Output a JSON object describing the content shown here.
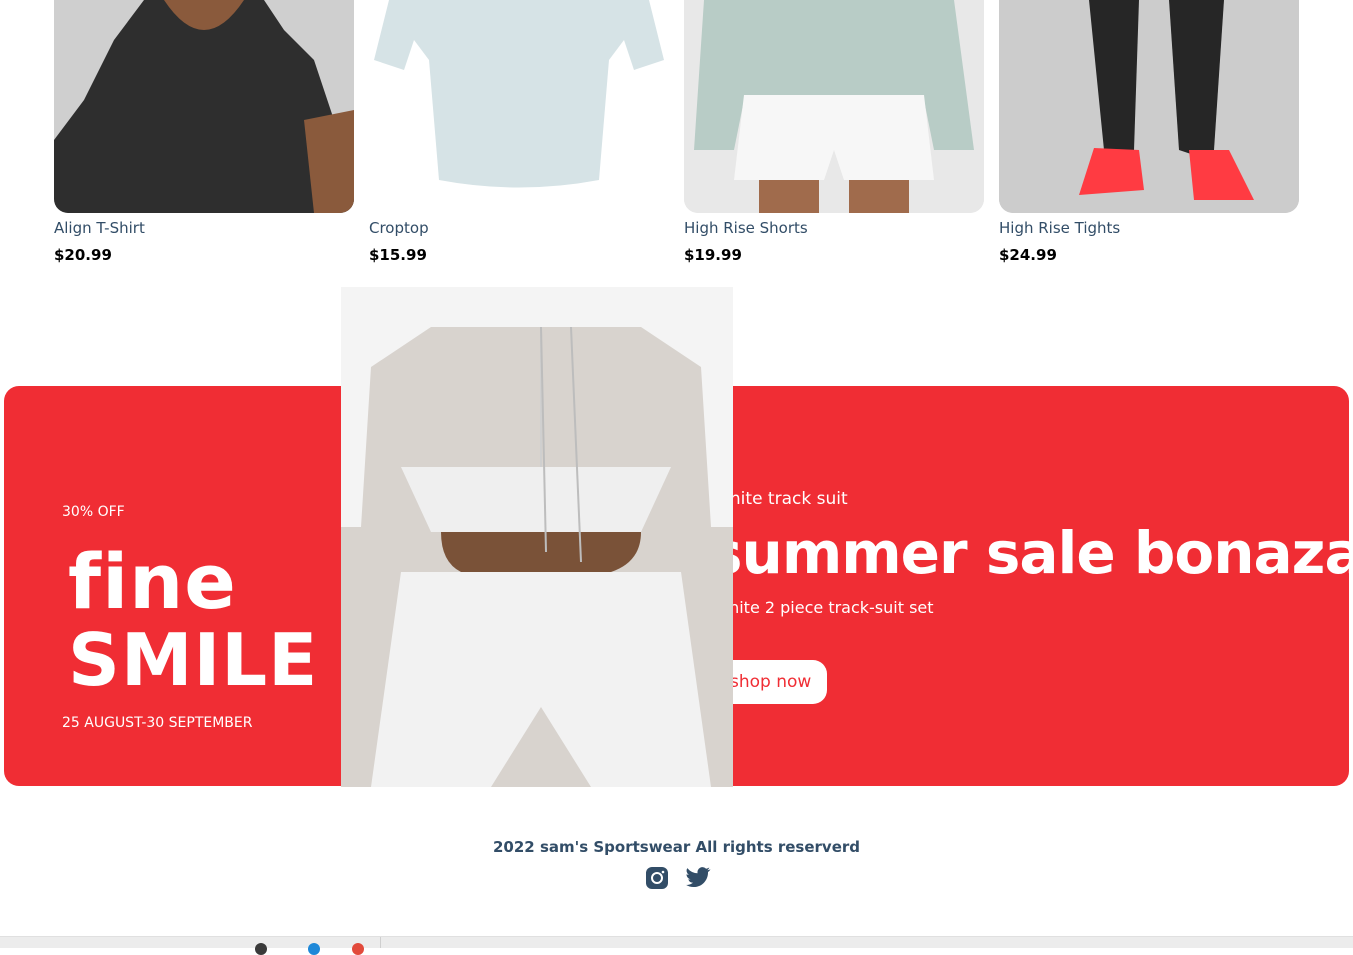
{
  "products": [
    {
      "name": "Align T-Shirt",
      "price": "$20.99",
      "image": "dark-tshirt-photo"
    },
    {
      "name": "Croptop",
      "price": "$15.99",
      "image": "light-blue-croptop-photo"
    },
    {
      "name": "High Rise Shorts",
      "price": "$19.99",
      "image": "sage-sweatshirt-white-shorts-photo"
    },
    {
      "name": "High Rise Tights",
      "price": "$24.99",
      "image": "black-tights-red-sneakers-photo"
    }
  ],
  "banner": {
    "discount": "30% OFF",
    "large_text_1": "fine",
    "large_text_2": "SMILE",
    "sale_time": "25 AUGUST-30 SEPTEMBER",
    "small_text": "white track suit",
    "mid_text": "summer sale bonaza",
    "description": "white 2 piece track-suit set",
    "button_label": "shop now",
    "image": "white-tracksuit-photo",
    "bg_color": "#f02d34"
  },
  "footer": {
    "copyright": "2022 sam's Sportswear All rights reserverd",
    "icons": [
      "instagram-icon",
      "twitter-icon"
    ]
  }
}
